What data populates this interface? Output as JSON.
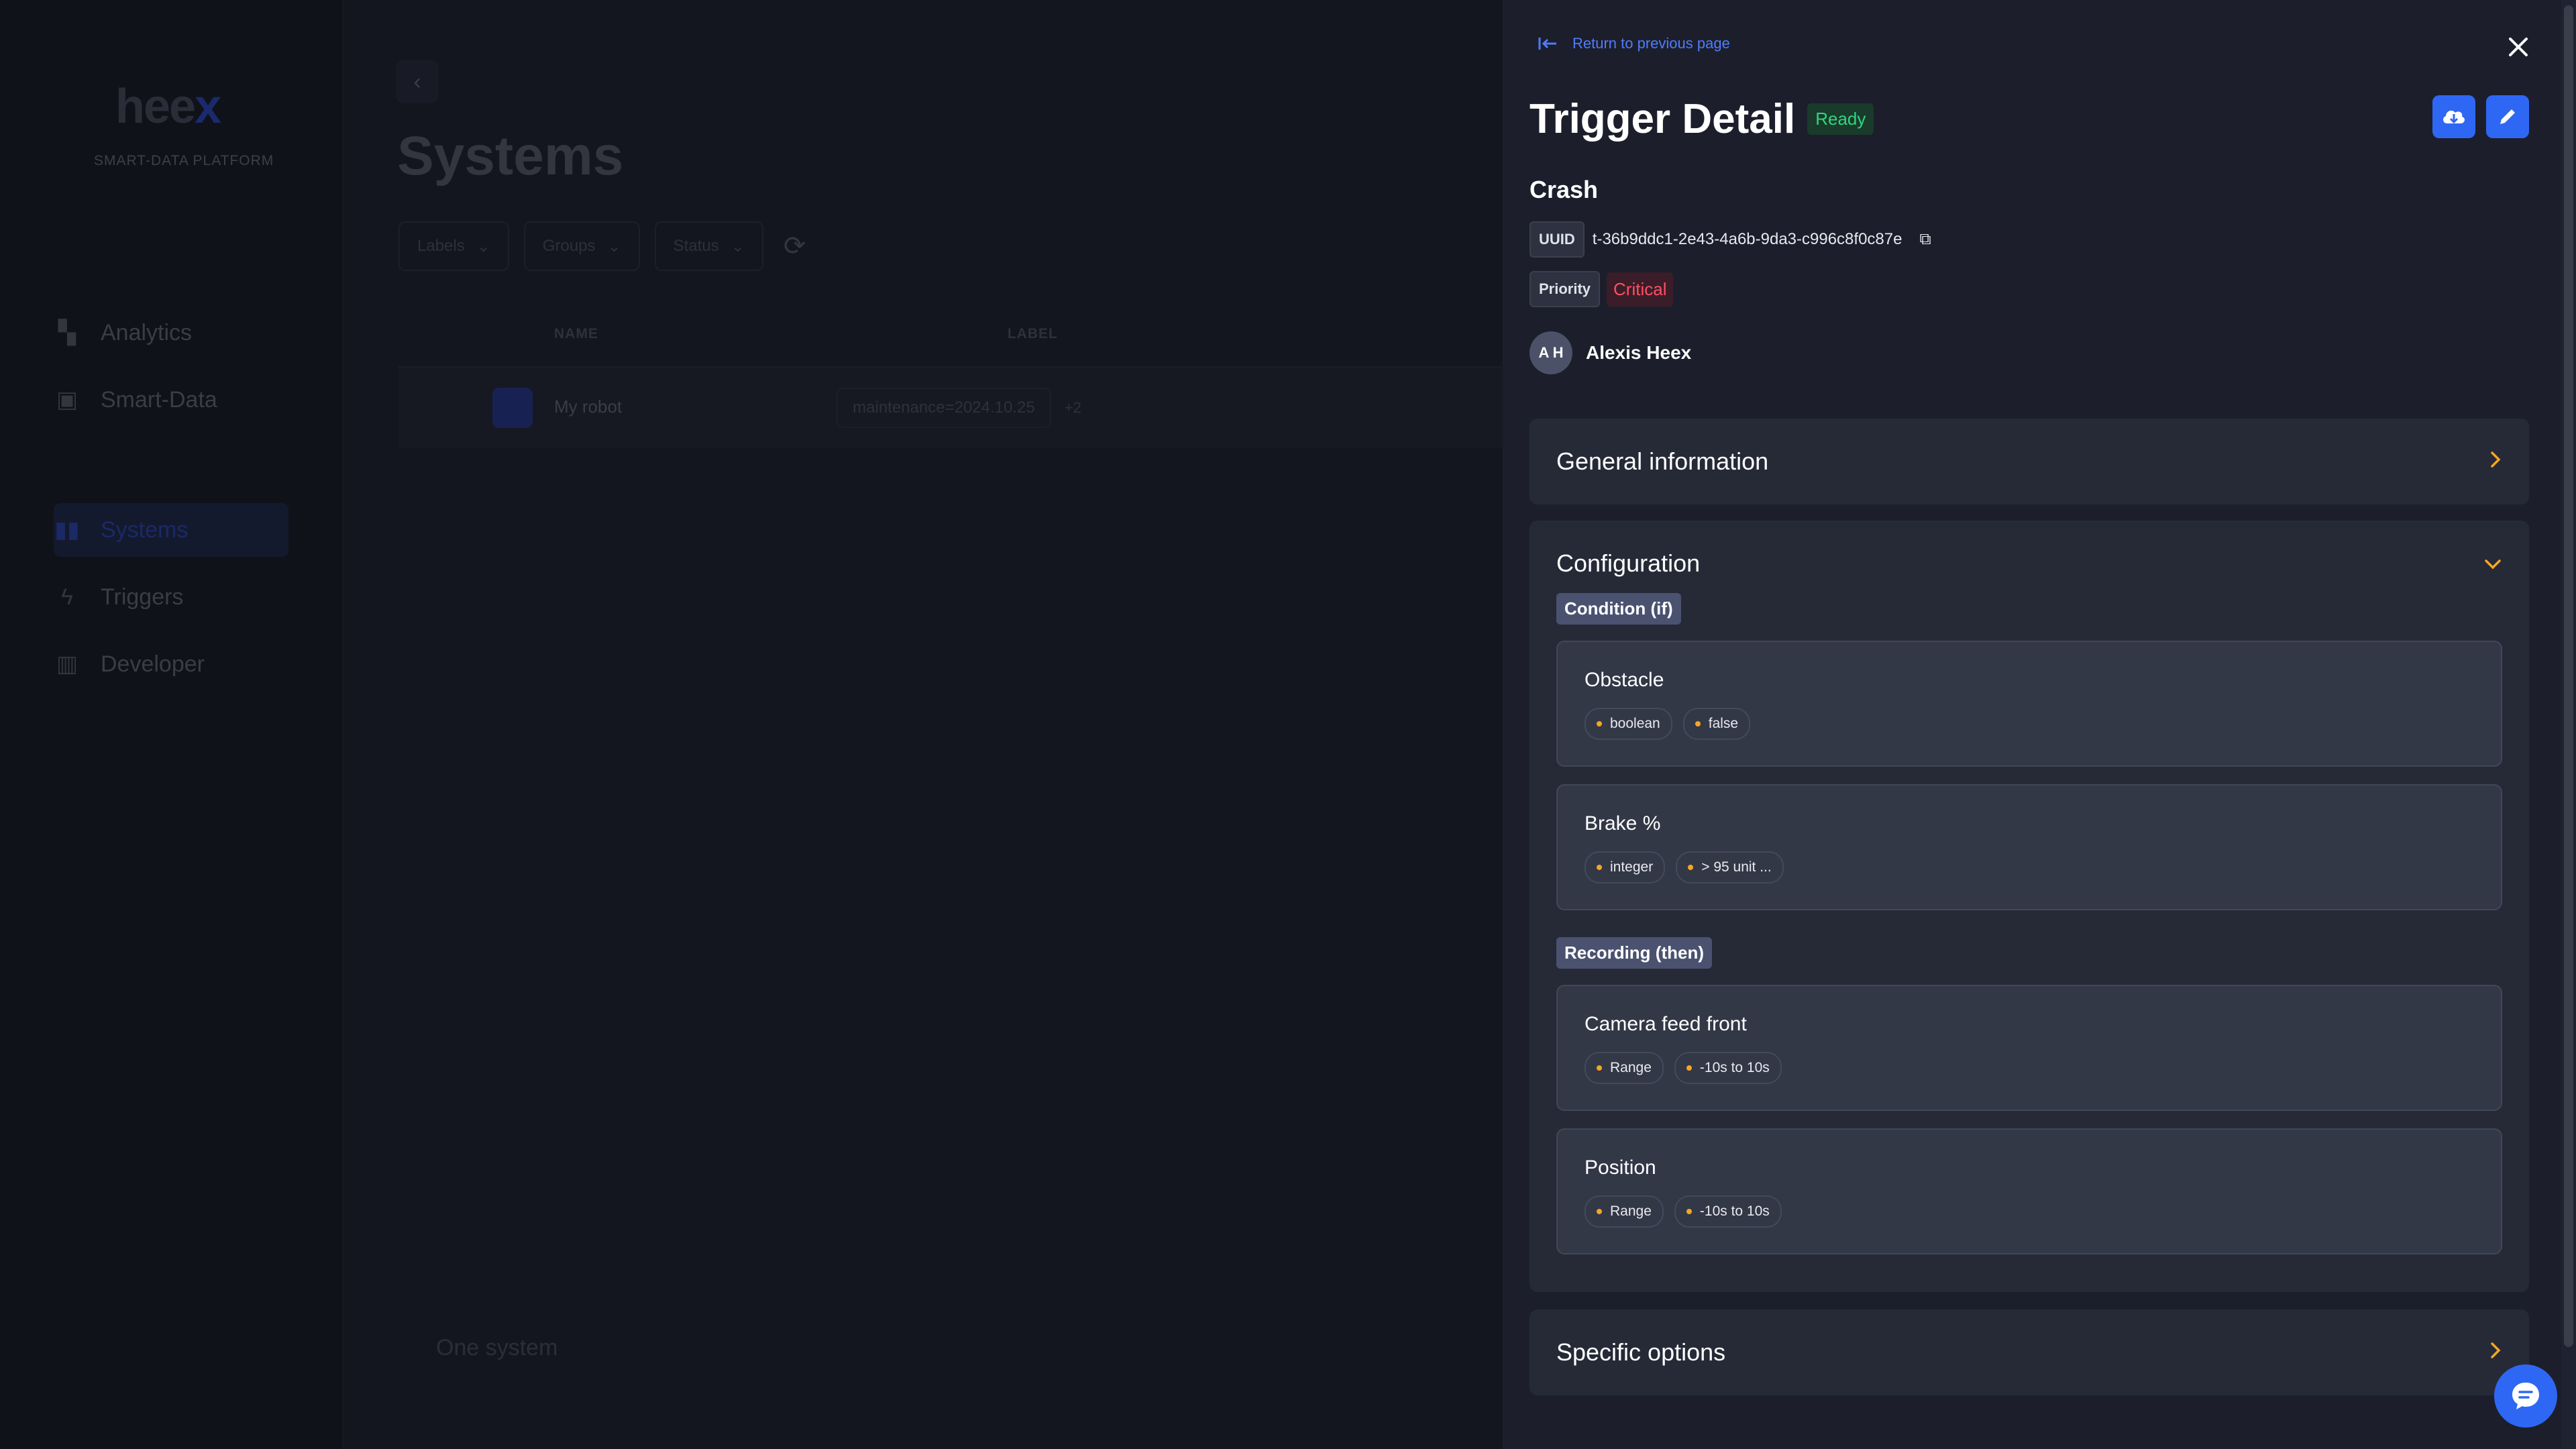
{
  "background": {
    "logo": {
      "text": "hee",
      "accent": "x"
    },
    "tagline": "SMART-DATA PLATFORM",
    "nav": [
      {
        "label": "Analytics",
        "icon": "analytics-icon"
      },
      {
        "label": "Smart-Data",
        "icon": "database-icon"
      },
      {
        "label": "Systems",
        "icon": "systems-icon",
        "active": true
      },
      {
        "label": "Triggers",
        "icon": "bolt-icon"
      },
      {
        "label": "Developer",
        "icon": "developer-icon"
      }
    ],
    "page_title": "Systems",
    "filters": [
      "Labels",
      "Groups",
      "Status"
    ],
    "table": {
      "headers": {
        "name": "NAME",
        "label": "LABEL"
      },
      "row": {
        "name": "My robot",
        "label": "maintenance=2024.10.25",
        "more": "+2"
      }
    },
    "count_text": "One system"
  },
  "drawer": {
    "return_label": "Return to previous page",
    "title": "Trigger Detail",
    "status": "Ready",
    "trigger_name": "Crash",
    "uuid_label": "UUID",
    "uuid_value": "t-36b9ddc1-2e43-4a6b-9da3-c996c8f0c87e",
    "priority_label": "Priority",
    "priority_value": "Critical",
    "user": {
      "initials": "A H",
      "name": "Alexis Heex"
    },
    "general_info_title": "General information",
    "configuration": {
      "title": "Configuration",
      "condition_label": "Condition (if)",
      "conditions": [
        {
          "title": "Obstacle",
          "tags": [
            "boolean",
            "false"
          ]
        },
        {
          "title": "Brake %",
          "tags": [
            "integer",
            "> 95 unit ..."
          ]
        }
      ],
      "recording_label": "Recording (then)",
      "recordings": [
        {
          "title": "Camera feed front",
          "tags": [
            "Range",
            "-10s to 10s"
          ]
        },
        {
          "title": "Position",
          "tags": [
            "Range",
            "-10s to 10s"
          ]
        }
      ]
    },
    "specific_options_title": "Specific options"
  },
  "colors": {
    "accent": "#2f67f5",
    "ready": "#2fd77e",
    "critical": "#ff4f63",
    "chevron": "#f5a623"
  }
}
